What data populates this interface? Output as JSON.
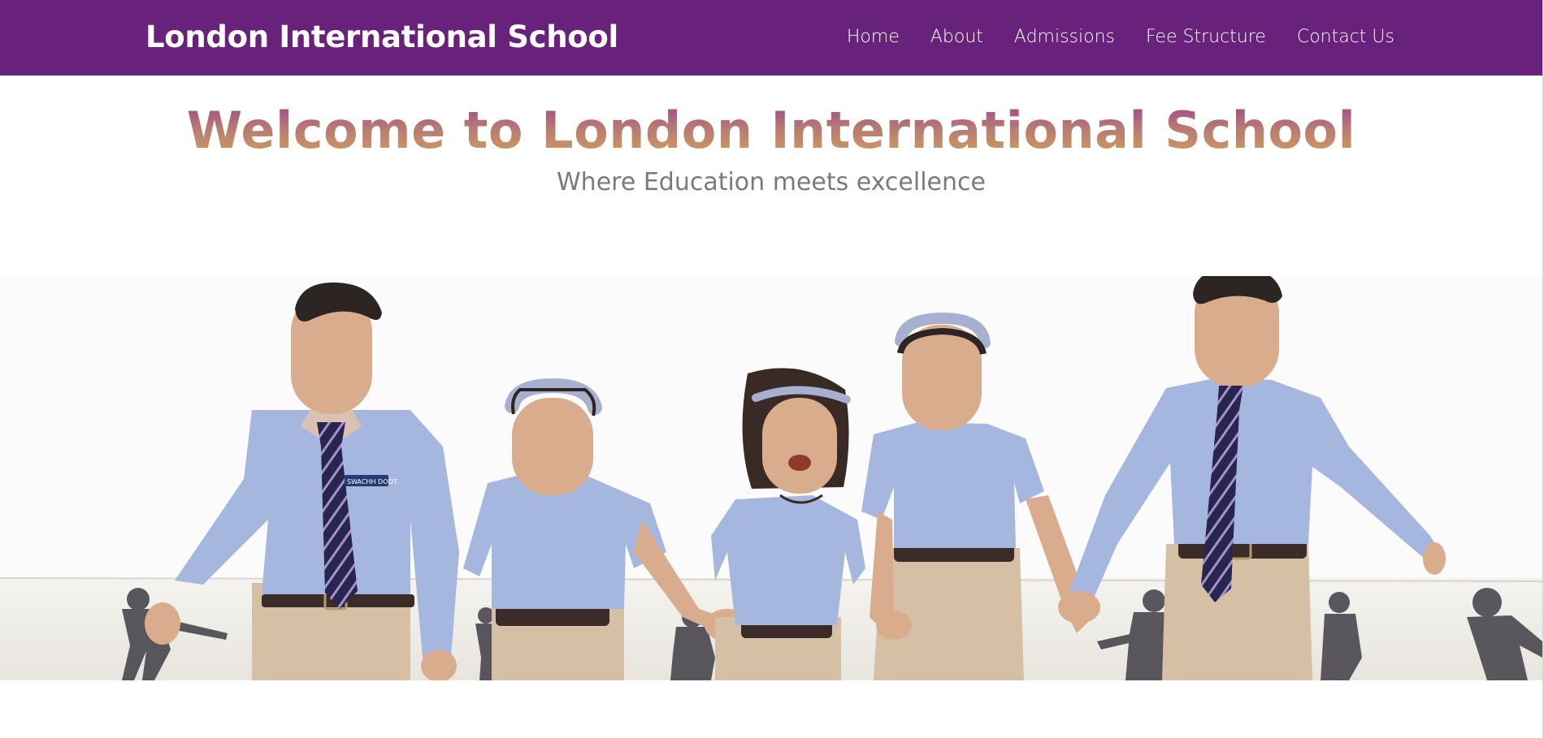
{
  "header": {
    "brand": "London International School",
    "nav": [
      {
        "label": "Home"
      },
      {
        "label": "About"
      },
      {
        "label": "Admissions"
      },
      {
        "label": "Fee Structure"
      },
      {
        "label": "Contact Us"
      }
    ]
  },
  "hero": {
    "title": "Welcome to London International School",
    "subtitle": "Where Education meets excellence",
    "image": {
      "badge_text": "SWACHH DOOT"
    }
  },
  "colors": {
    "navbar_bg": "#68227c",
    "nav_text": "#ffffff",
    "title_gradient_start": "#9a3e8f",
    "title_gradient_end": "#d4a35a",
    "subtitle": "#7a7a7a",
    "shirt": "#a6b7df",
    "trousers": "#d5c0a6",
    "tie": "#27264d"
  }
}
